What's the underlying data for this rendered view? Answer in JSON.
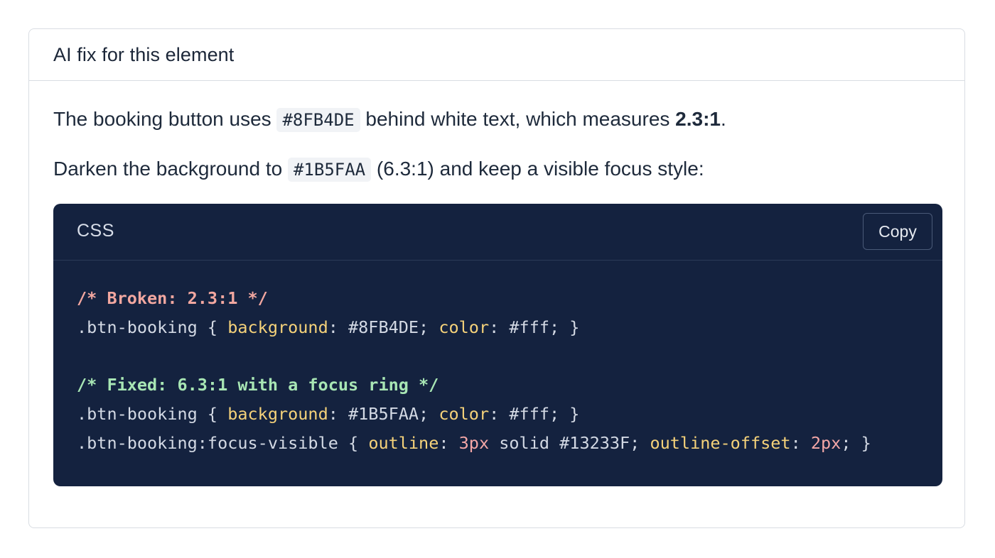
{
  "card": {
    "title": "AI fix for this element"
  },
  "explanation": {
    "p1_before": "The booking button uses ",
    "p1_code": "#8FB4DE",
    "p1_after": " behind white text, which measures ",
    "p1_ratio": "2.3:1",
    "p1_end": ".",
    "p2_before": "Darken the background to ",
    "p2_code": "#1B5FAA",
    "p2_after": " (6.3:1) and keep a visible focus style:"
  },
  "code_block": {
    "language": "CSS",
    "copy_label": "Copy",
    "lines": [
      {
        "tokens": [
          {
            "text": "/* Broken: 2.3:1 */",
            "kind": "broken"
          }
        ]
      },
      {
        "tokens": [
          {
            "text": ".btn-booking { ",
            "kind": "plain"
          },
          {
            "text": "background",
            "kind": "prop"
          },
          {
            "text": ": #8FB4DE; ",
            "kind": "plain"
          },
          {
            "text": "color",
            "kind": "prop"
          },
          {
            "text": ": #fff; }",
            "kind": "plain"
          }
        ]
      },
      {
        "tokens": []
      },
      {
        "tokens": [
          {
            "text": "/* Fixed: 6.3:1 with a focus ring */",
            "kind": "fixed"
          }
        ]
      },
      {
        "tokens": [
          {
            "text": ".btn-booking { ",
            "kind": "plain"
          },
          {
            "text": "background",
            "kind": "prop"
          },
          {
            "text": ": #1B5FAA; ",
            "kind": "plain"
          },
          {
            "text": "color",
            "kind": "prop"
          },
          {
            "text": ": #fff; }",
            "kind": "plain"
          }
        ]
      },
      {
        "tokens": [
          {
            "text": ".btn-booking:focus-visible { ",
            "kind": "plain"
          },
          {
            "text": "outline",
            "kind": "prop"
          },
          {
            "text": ": ",
            "kind": "plain"
          },
          {
            "text": "3px",
            "kind": "num"
          },
          {
            "text": " solid #13233F; ",
            "kind": "plain"
          },
          {
            "text": "outline-offset",
            "kind": "prop"
          },
          {
            "text": ": ",
            "kind": "plain"
          },
          {
            "text": "2px",
            "kind": "num"
          },
          {
            "text": "; }",
            "kind": "plain"
          }
        ]
      }
    ]
  },
  "colors": {
    "code_background": "#14223F",
    "comment_broken": "#F2A7A0",
    "comment_fixed": "#A8E6B4",
    "property": "#F5D27A",
    "number": "#F4A7A7"
  }
}
